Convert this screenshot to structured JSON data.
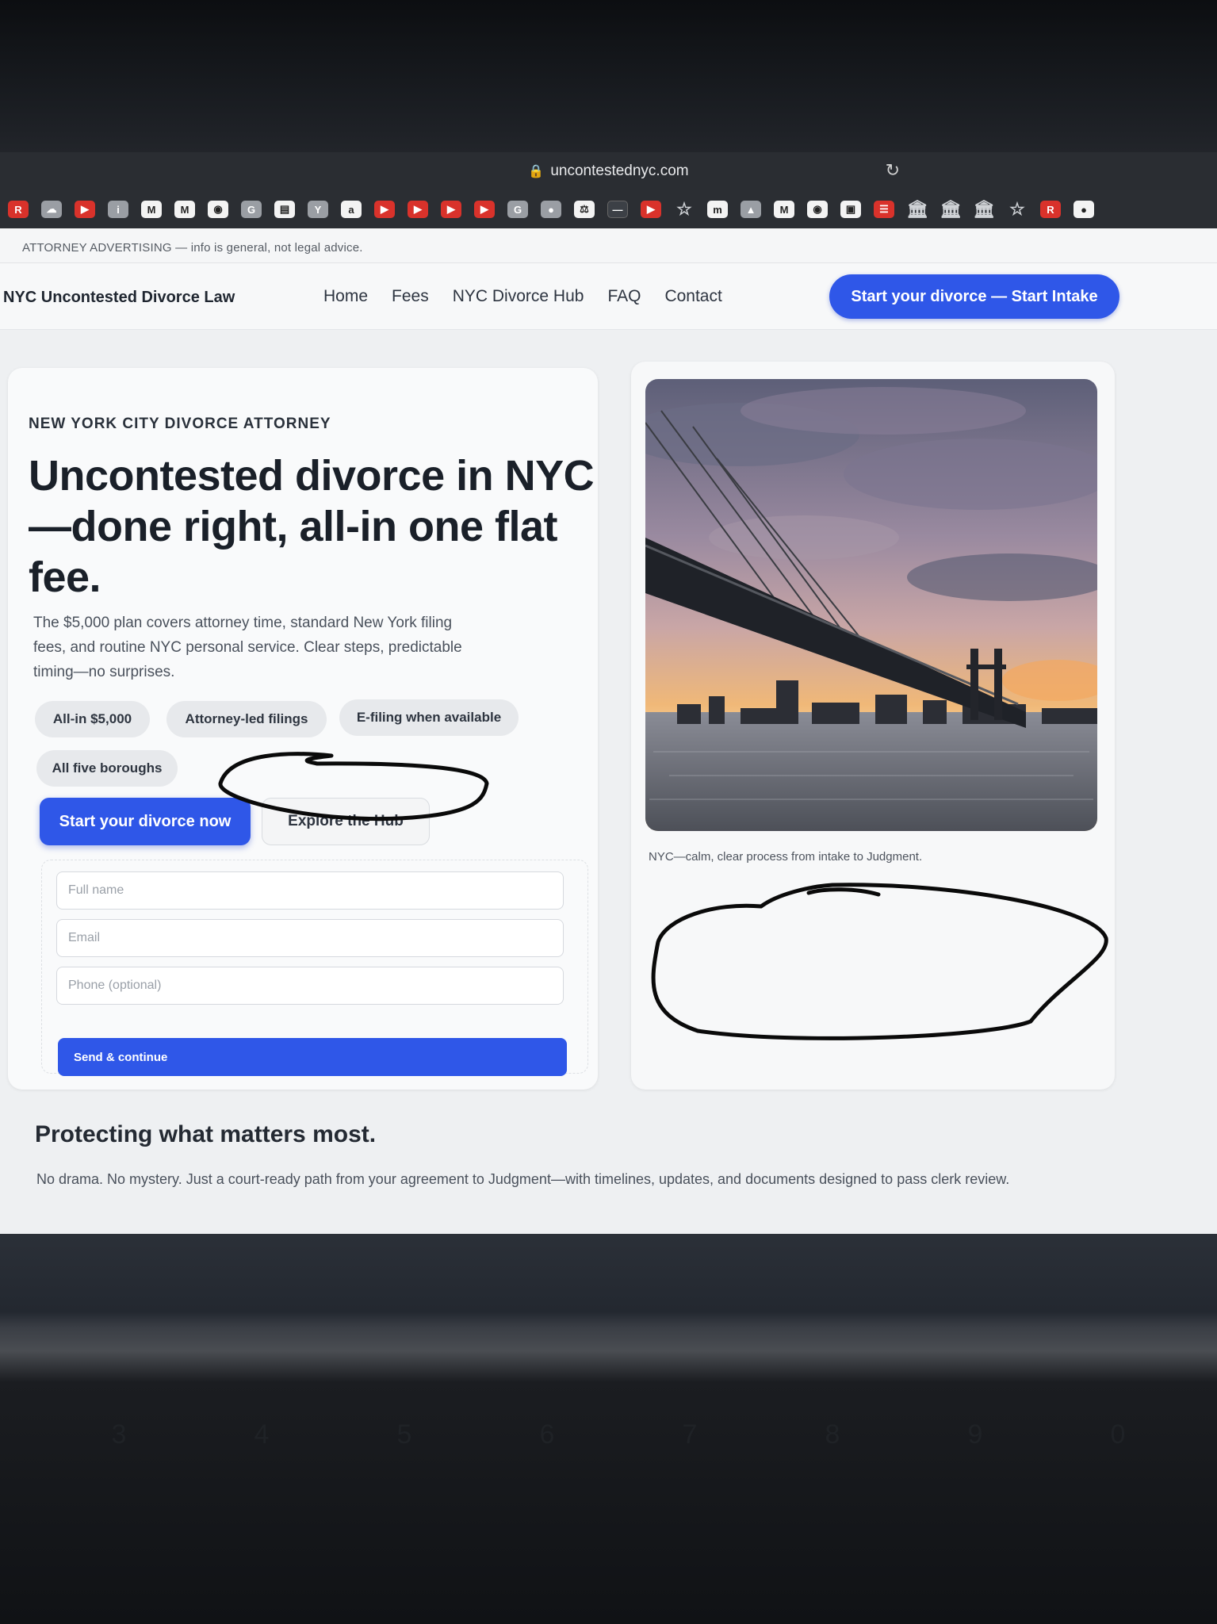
{
  "browser": {
    "url": "uncontestednyc.com",
    "bookmark_icons": [
      "r-logo-icon",
      "cloud-icon",
      "youtube-icon",
      "info-icon",
      "gmail-icon",
      "gmail-icon",
      "app-icon",
      "g-icon",
      "chart-icon",
      "ya-icon",
      "amazon-icon",
      "youtube-icon",
      "youtube-icon",
      "youtube-icon",
      "youtube-icon",
      "g-icon",
      "circle-icon",
      "law-icon",
      "dash-icon",
      "youtube-icon",
      "star-icon",
      "mat-icon",
      "bird-icon",
      "gmail-icon",
      "github-icon",
      "square-icon",
      "news-icon",
      "bank-icon",
      "bank-icon",
      "bank-icon",
      "star-icon",
      "r-app-icon",
      "power-icon"
    ]
  },
  "adbar": {
    "text": "ATTORNEY ADVERTISING — info is general, not legal advice."
  },
  "nav": {
    "brand": "NYC Uncontested Divorce Law",
    "links": [
      "Home",
      "Fees",
      "NYC Divorce Hub",
      "FAQ",
      "Contact"
    ],
    "cta": "Start your divorce — Start Intake"
  },
  "hero": {
    "eyebrow": "NEW YORK CITY DIVORCE ATTORNEY",
    "headline": "Uncontested divorce in NYC—done right, all-in one flat fee.",
    "lede": "The $5,000 plan covers attorney time, standard New York filing fees, and routine NYC personal service. Clear steps, predictable timing—no surprises.",
    "chips": [
      "All-in $5,000",
      "Attorney-led filings",
      "E-filing when available",
      "All five boroughs"
    ],
    "primary_button": "Start your divorce now",
    "secondary_button": "Explore the Hub"
  },
  "form": {
    "name_placeholder": "Full name",
    "email_placeholder": "Email",
    "phone_placeholder": "Phone (optional)",
    "submit": "Send & continue"
  },
  "media": {
    "caption": "NYC—calm, clear process from intake to Judgment."
  },
  "section": {
    "title": "Protecting what matters most.",
    "text": "No drama. No mystery. Just a court-ready path from your agreement to Judgment—with timelines, updates, and documents designed to pass clerk review."
  },
  "keyboard": {
    "digits": [
      "3",
      "4",
      "5",
      "6",
      "7",
      "8",
      "9",
      "0"
    ]
  },
  "colors": {
    "accent": "#2f57e8",
    "page_bg": "#eef0f2",
    "card_bg": "#f9fafb"
  }
}
